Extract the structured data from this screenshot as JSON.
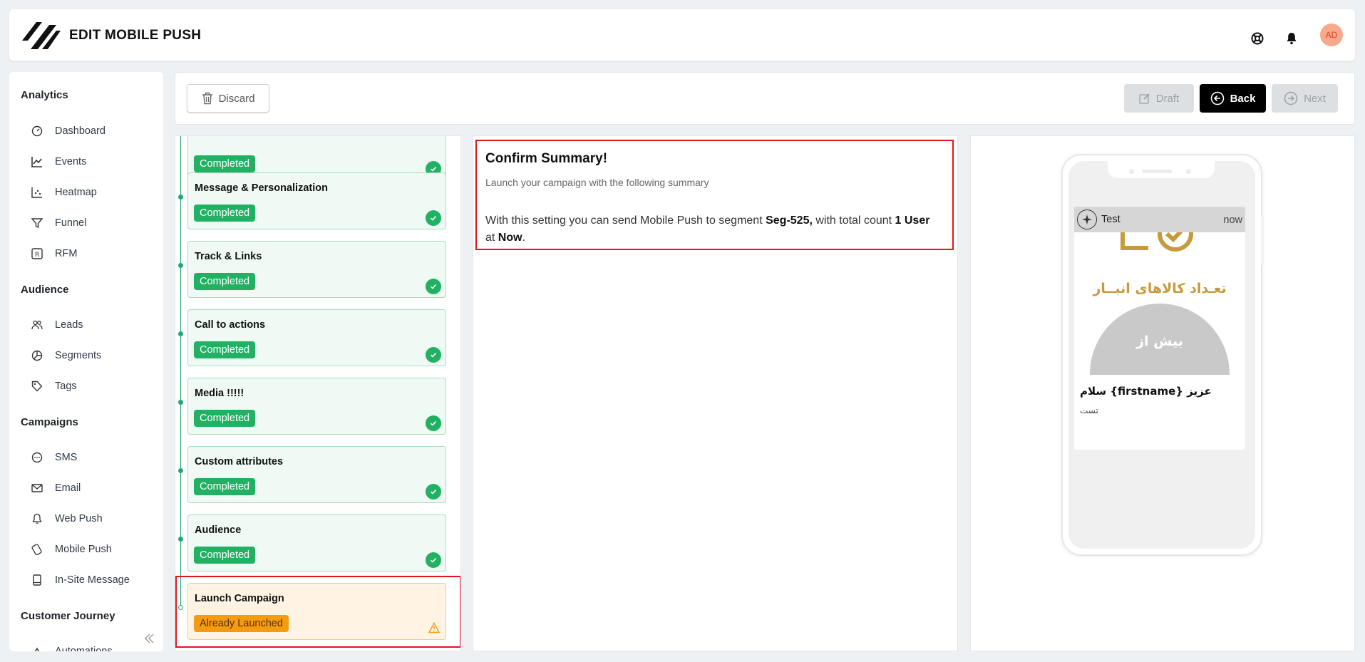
{
  "header": {
    "title": "EDIT MOBILE PUSH",
    "avatar_initials": "AD"
  },
  "sidebar": {
    "sections": [
      {
        "label": "Analytics",
        "items": [
          {
            "label": "Dashboard",
            "icon": "gauge-icon"
          },
          {
            "label": "Events",
            "icon": "line-chart-icon"
          },
          {
            "label": "Heatmap",
            "icon": "scatter-chart-icon"
          },
          {
            "label": "Funnel",
            "icon": "funnel-icon"
          },
          {
            "label": "RFM",
            "icon": "rfm-icon"
          }
        ]
      },
      {
        "label": "Audience",
        "items": [
          {
            "label": "Leads",
            "icon": "users-icon"
          },
          {
            "label": "Segments",
            "icon": "pie-chart-icon"
          },
          {
            "label": "Tags",
            "icon": "tag-icon"
          }
        ]
      },
      {
        "label": "Campaigns",
        "items": [
          {
            "label": "SMS",
            "icon": "chat-icon"
          },
          {
            "label": "Email",
            "icon": "mail-icon"
          },
          {
            "label": "Web Push",
            "icon": "bell-icon"
          },
          {
            "label": "Mobile Push",
            "icon": "mobile-push-icon"
          },
          {
            "label": "In-Site Message",
            "icon": "tablet-icon"
          }
        ]
      },
      {
        "label": "Customer Journey",
        "items": [
          {
            "label": "Automations",
            "icon": "automation-icon"
          }
        ]
      }
    ]
  },
  "toolbar": {
    "discard": "Discard",
    "draft": "Draft",
    "back": "Back",
    "next": "Next"
  },
  "steps": [
    {
      "title": "",
      "status": "Completed"
    },
    {
      "title": "Message & Personalization",
      "status": "Completed"
    },
    {
      "title": "Track & Links",
      "status": "Completed"
    },
    {
      "title": "Call to actions",
      "status": "Completed"
    },
    {
      "title": "Media !!!!!",
      "status": "Completed"
    },
    {
      "title": "Custom attributes",
      "status": "Completed"
    },
    {
      "title": "Audience",
      "status": "Completed"
    },
    {
      "title": "Launch Campaign",
      "status": "Already Launched"
    }
  ],
  "summary": {
    "title": "Confirm Summary!",
    "subtitle": "Launch your campaign with the following summary",
    "text_1": "With this setting you can send Mobile Push to segment ",
    "segment": "Seg-525,",
    "text_2": " with total count ",
    "count": "1 User",
    "text_3": " at ",
    "when": "Now",
    "text_4": "."
  },
  "preview": {
    "app_name": "Test",
    "time": "now",
    "image_text_1": "تعـداد کالاهای انبــار",
    "image_text_2": "بیش از",
    "title": "سلام {firstname} عزیز",
    "body": "تست"
  },
  "colors": {
    "success": "#22b063",
    "warning": "#f59b12",
    "highlight": "#e4141b",
    "primary": "#000000"
  }
}
